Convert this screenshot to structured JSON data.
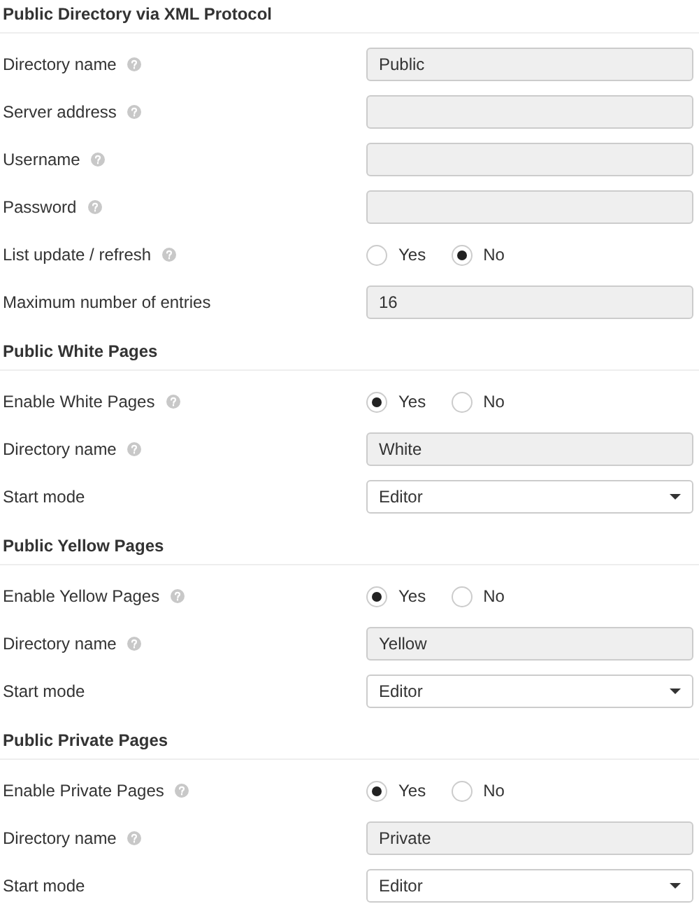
{
  "sections": [
    {
      "title": "Public Directory via XML Protocol",
      "rows": [
        {
          "kind": "text",
          "label": "Directory name",
          "help": true,
          "value": "Public"
        },
        {
          "kind": "text",
          "label": "Server address",
          "help": true
        },
        {
          "kind": "text",
          "label": "Username",
          "help": true
        },
        {
          "kind": "text",
          "label": "Password",
          "help": true
        },
        {
          "kind": "radio",
          "label": "List update / refresh",
          "help": true,
          "options": [
            {
              "label": "Yes",
              "selected": false
            },
            {
              "label": "No",
              "selected": true
            }
          ]
        },
        {
          "kind": "text",
          "label": "Maximum number of entries",
          "help": false,
          "value": "16"
        }
      ]
    },
    {
      "title": "Public White Pages",
      "rows": [
        {
          "kind": "radio",
          "label": "Enable White Pages",
          "help": true,
          "options": [
            {
              "label": "Yes",
              "selected": true
            },
            {
              "label": "No",
              "selected": false
            }
          ]
        },
        {
          "kind": "text",
          "label": "Directory name",
          "help": true,
          "value": "White"
        },
        {
          "kind": "select",
          "label": "Start mode",
          "help": false,
          "value": "Editor"
        }
      ]
    },
    {
      "title": "Public Yellow Pages",
      "rows": [
        {
          "kind": "radio",
          "label": "Enable Yellow Pages",
          "help": true,
          "options": [
            {
              "label": "Yes",
              "selected": true
            },
            {
              "label": "No",
              "selected": false
            }
          ]
        },
        {
          "kind": "text",
          "label": "Directory name",
          "help": true,
          "value": "Yellow"
        },
        {
          "kind": "select",
          "label": "Start mode",
          "help": false,
          "value": "Editor"
        }
      ]
    },
    {
      "title": "Public Private Pages",
      "rows": [
        {
          "kind": "radio",
          "label": "Enable Private Pages",
          "help": true,
          "options": [
            {
              "label": "Yes",
              "selected": true
            },
            {
              "label": "No",
              "selected": false
            }
          ]
        },
        {
          "kind": "text",
          "label": "Directory name",
          "help": true,
          "value": "Private"
        },
        {
          "kind": "select",
          "label": "Start mode",
          "help": false,
          "value": "Editor"
        }
      ]
    }
  ]
}
